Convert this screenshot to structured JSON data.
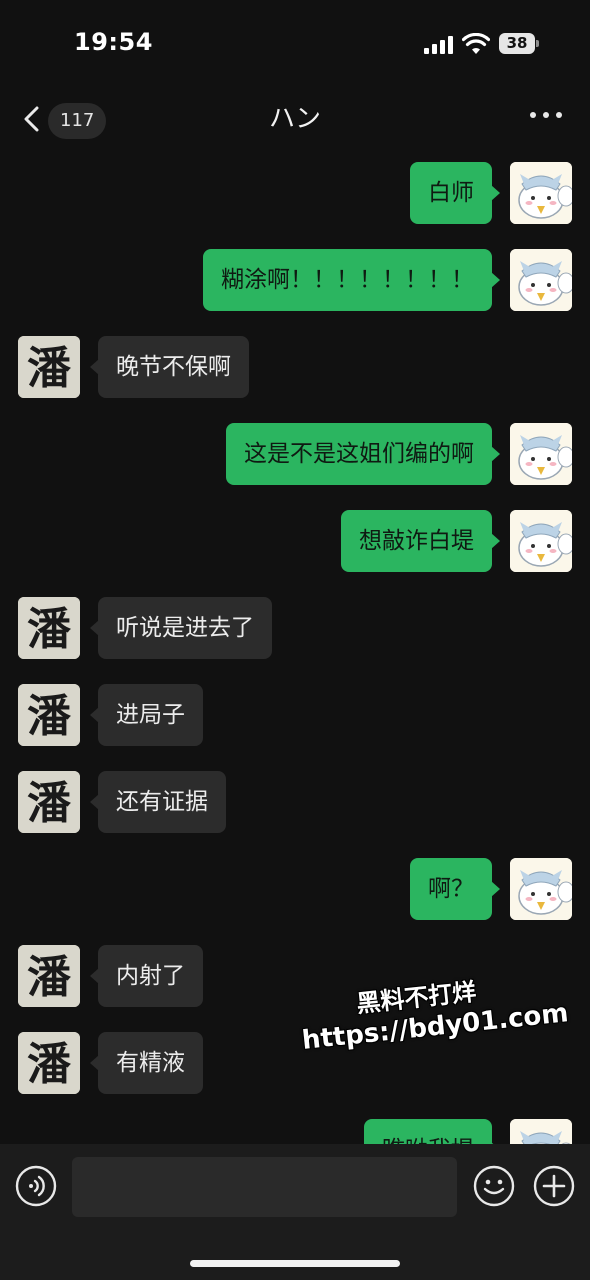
{
  "status_bar": {
    "time": "19:54",
    "battery_level": "38",
    "icons": [
      "cellular-signal-icon",
      "wifi-icon",
      "battery-icon"
    ]
  },
  "nav": {
    "unread_count": "117",
    "title": "ハン",
    "back_icon": "chevron-left-icon",
    "more_icon": "more-dots-icon"
  },
  "messages": [
    {
      "from": "me",
      "text": "白师"
    },
    {
      "from": "me",
      "text": "糊涂啊！！！！！！！！"
    },
    {
      "from": "contact",
      "text": "晚节不保啊"
    },
    {
      "from": "me",
      "text": "这是不是这姐们编的啊"
    },
    {
      "from": "me",
      "text": "想敲诈白堤"
    },
    {
      "from": "contact",
      "text": "听说是进去了"
    },
    {
      "from": "contact",
      "text": "进局子"
    },
    {
      "from": "contact",
      "text": "还有证据"
    },
    {
      "from": "me",
      "text": "啊？"
    },
    {
      "from": "contact",
      "text": "内射了"
    },
    {
      "from": "contact",
      "text": "有精液"
    },
    {
      "from": "me",
      "text": "瞧呦我堤"
    }
  ],
  "contact_avatar_glyph": "潘",
  "watermark": {
    "line1": "黑料不打烊",
    "line2": "https://bdy01.com"
  },
  "input_bar": {
    "placeholder": "",
    "icons": [
      "voice-icon",
      "emoji-icon",
      "plus-icon"
    ]
  },
  "colors": {
    "background": "#111111",
    "outgoing_bubble": "#2bb560",
    "incoming_bubble": "#2c2c2c",
    "input_bar": "#1c1c1c"
  }
}
